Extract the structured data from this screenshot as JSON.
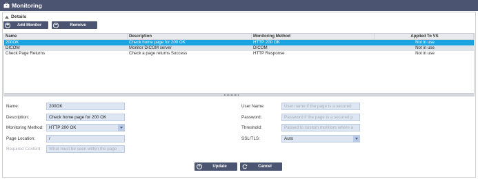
{
  "window": {
    "title": "Monitoring"
  },
  "details": {
    "label": "Details"
  },
  "toolbar": {
    "add_label": "Add Monitor",
    "remove_label": "Remove"
  },
  "table": {
    "columns": [
      "Name",
      "Description",
      "Monitoring Method",
      "Applied To VS"
    ],
    "rows": [
      {
        "name": "200OK",
        "description": "Check home page for 200 OK",
        "method": "HTTP 200 OK",
        "applied": "Not in use"
      },
      {
        "name": "DICOM",
        "description": "Monitor DICOM server",
        "method": "DICOM",
        "applied": "Not in use"
      },
      {
        "name": "Check Page Returns",
        "description": "Check a page returns Success",
        "method": "HTTP Response",
        "applied": "Not in use"
      }
    ]
  },
  "form": {
    "name_label": "Name:",
    "name_value": "200OK",
    "description_label": "Description:",
    "description_value": "Check home page for 200 OK",
    "method_label": "Monitoring Method:",
    "method_value": "HTTP 200 OK",
    "page_location_label": "Page Location:",
    "page_location_value": "/",
    "required_content_label": "Required Content:",
    "required_content_placeholder": "What must be seen within the page",
    "username_label": "User Name:",
    "username_placeholder": "User name if the page is a secured",
    "password_label": "Password:",
    "password_placeholder": "Password if the page is a secured p",
    "threshold_label": "Threshold:",
    "threshold_placeholder": "Passed to custom monitors where a",
    "ssl_label": "SSL/TLS:",
    "ssl_value": "Auto"
  },
  "actions": {
    "update_label": "Update",
    "cancel_label": "Cancel"
  },
  "colors": {
    "titlebar": "#4b5470",
    "selected_row": "#19a3e0",
    "field_bg": "#dde6f2"
  },
  "icons": {
    "window": "briefcase-icon",
    "add": "plus-circle-icon",
    "remove": "minus-circle-icon",
    "update": "plus-circle-icon",
    "cancel": "refresh-icon"
  }
}
